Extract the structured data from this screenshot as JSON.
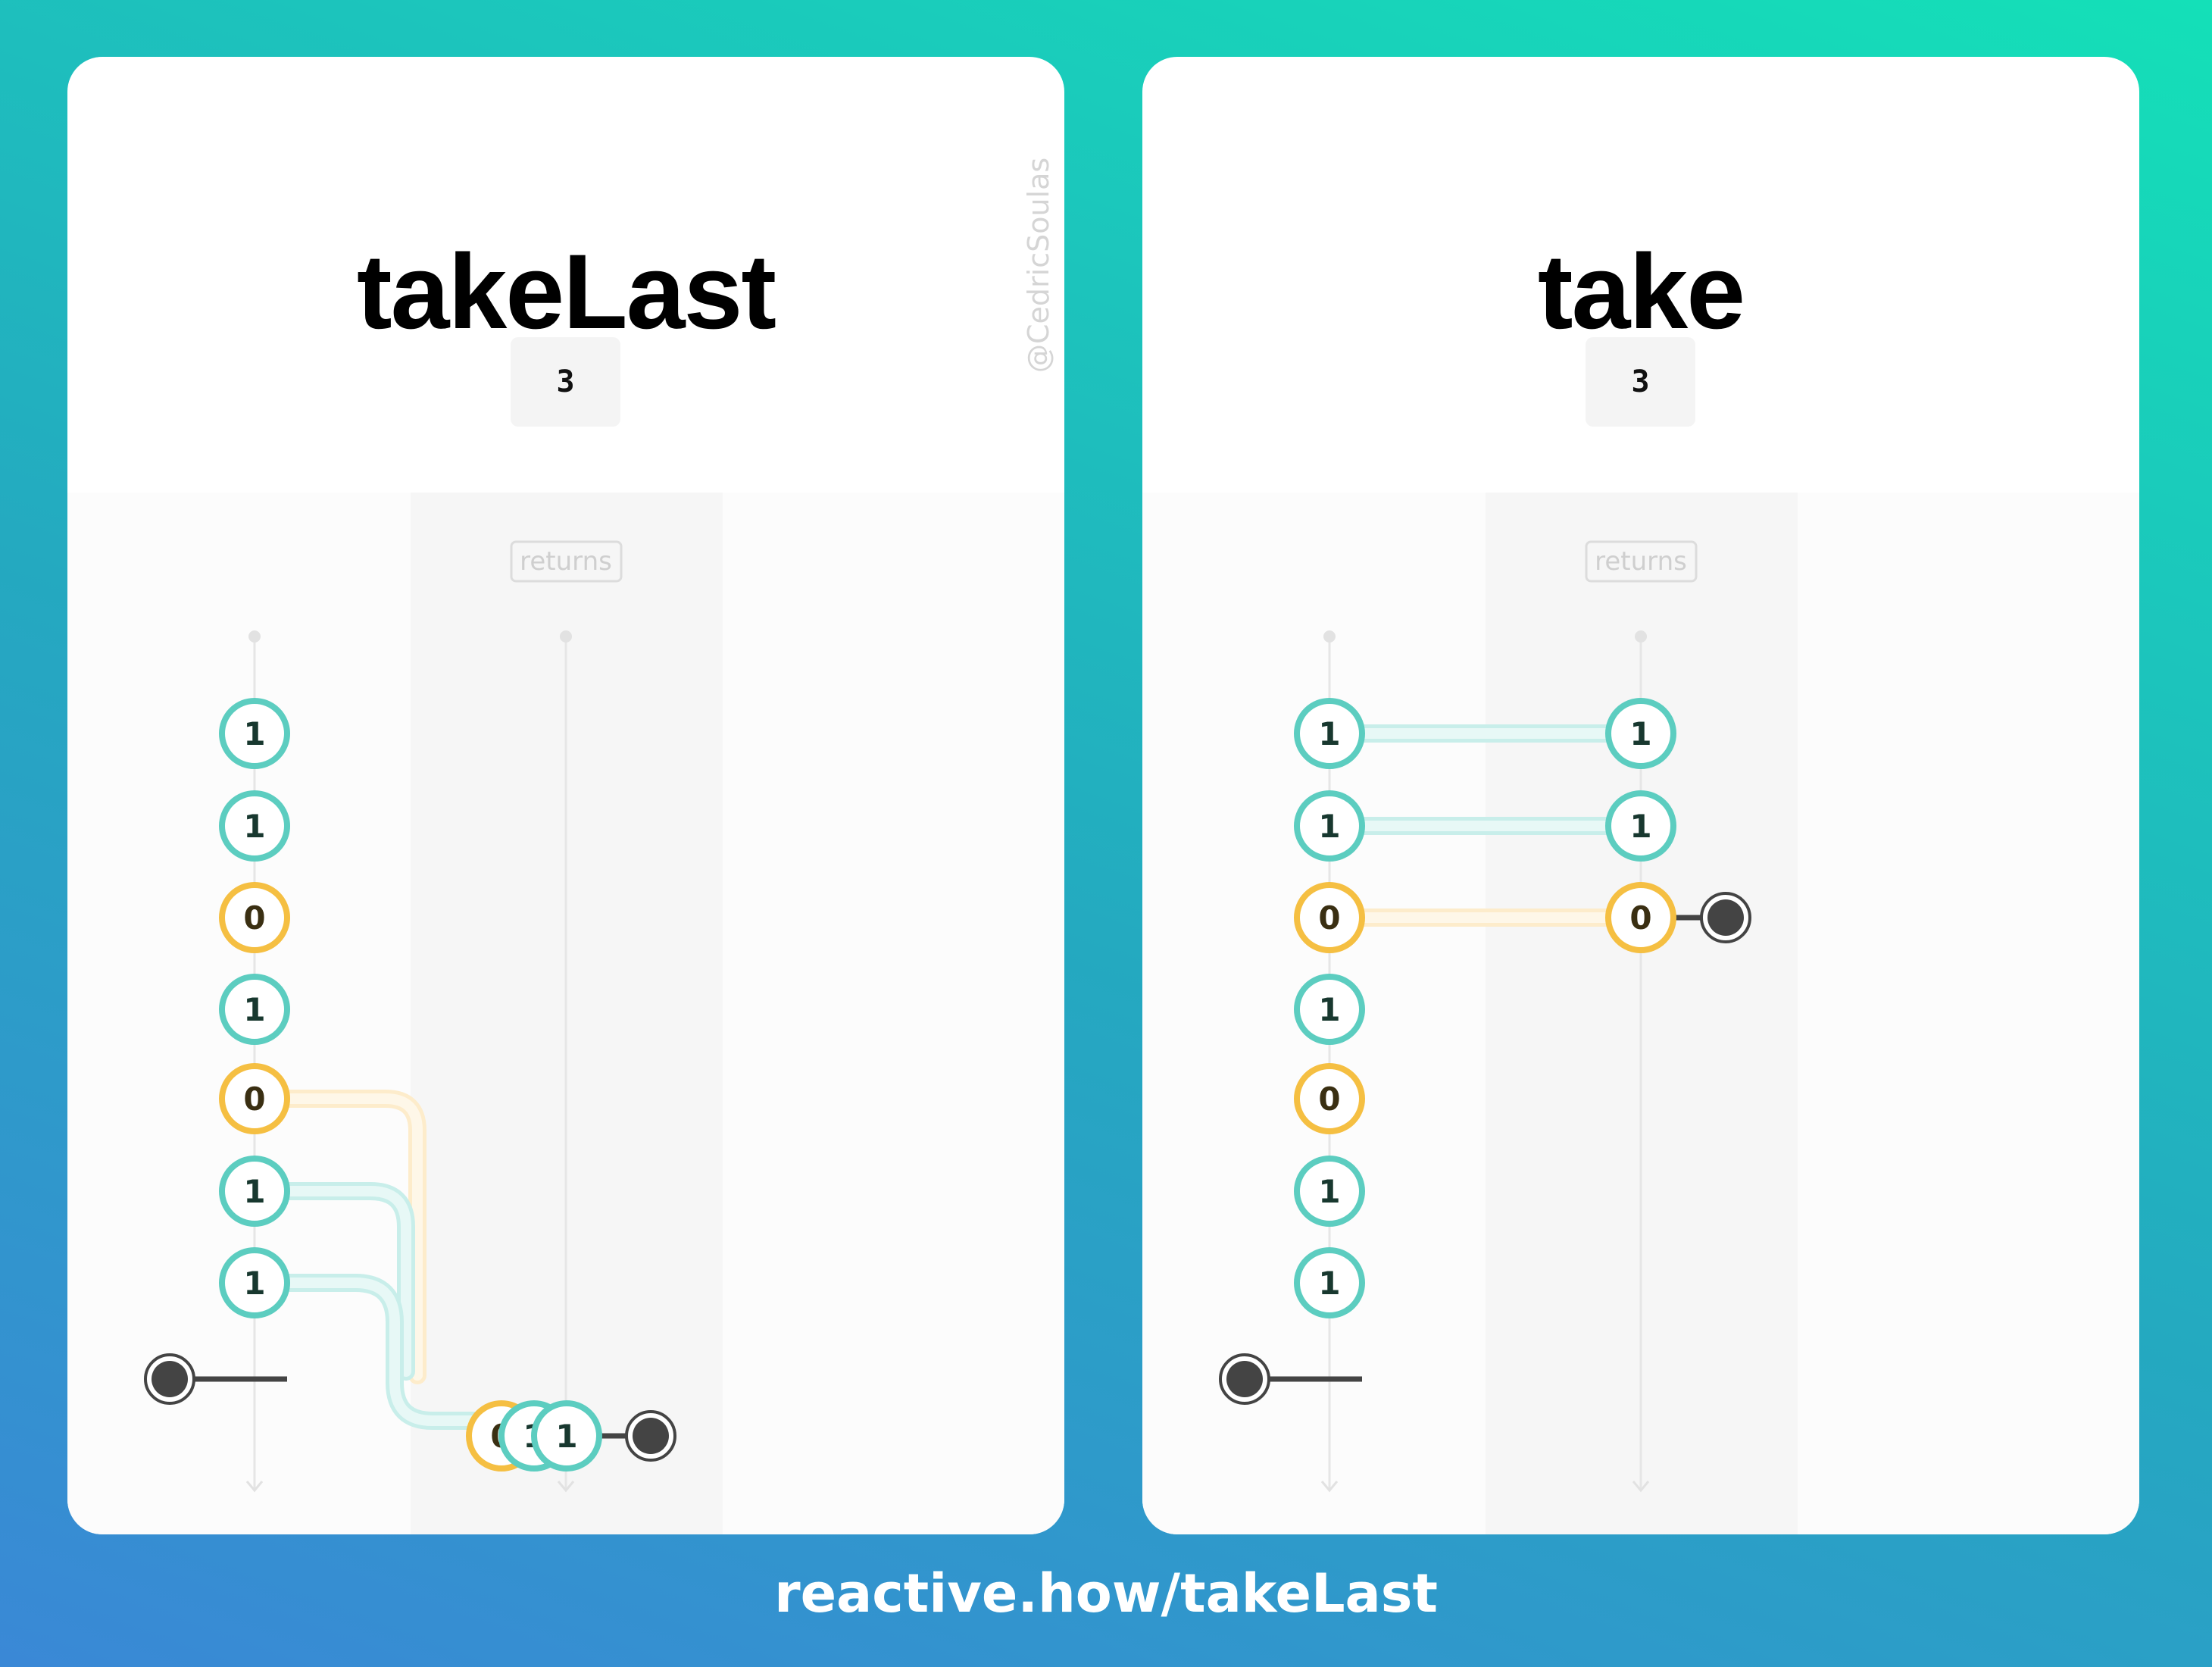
{
  "panels": [
    {
      "id": "left",
      "title": "takeLast",
      "argument": "3",
      "returns_label": "returns",
      "credit": "@CedricSoulas",
      "source_marbles": [
        "1",
        "1",
        "0",
        "1",
        "0",
        "1",
        "1"
      ],
      "output_marbles": [
        "0",
        "1",
        "1"
      ]
    },
    {
      "id": "right",
      "title": "take",
      "argument": "3",
      "returns_label": "returns",
      "source_marbles": [
        "1",
        "1",
        "0",
        "1",
        "0",
        "1",
        "1"
      ],
      "output_marbles": [
        "1",
        "1",
        "0"
      ]
    }
  ],
  "colors": {
    "teal": "#5ccdc0",
    "amber": "#f5bf42",
    "completion": "#444444"
  },
  "footer": {
    "url": "reactive.how/takeLast"
  }
}
